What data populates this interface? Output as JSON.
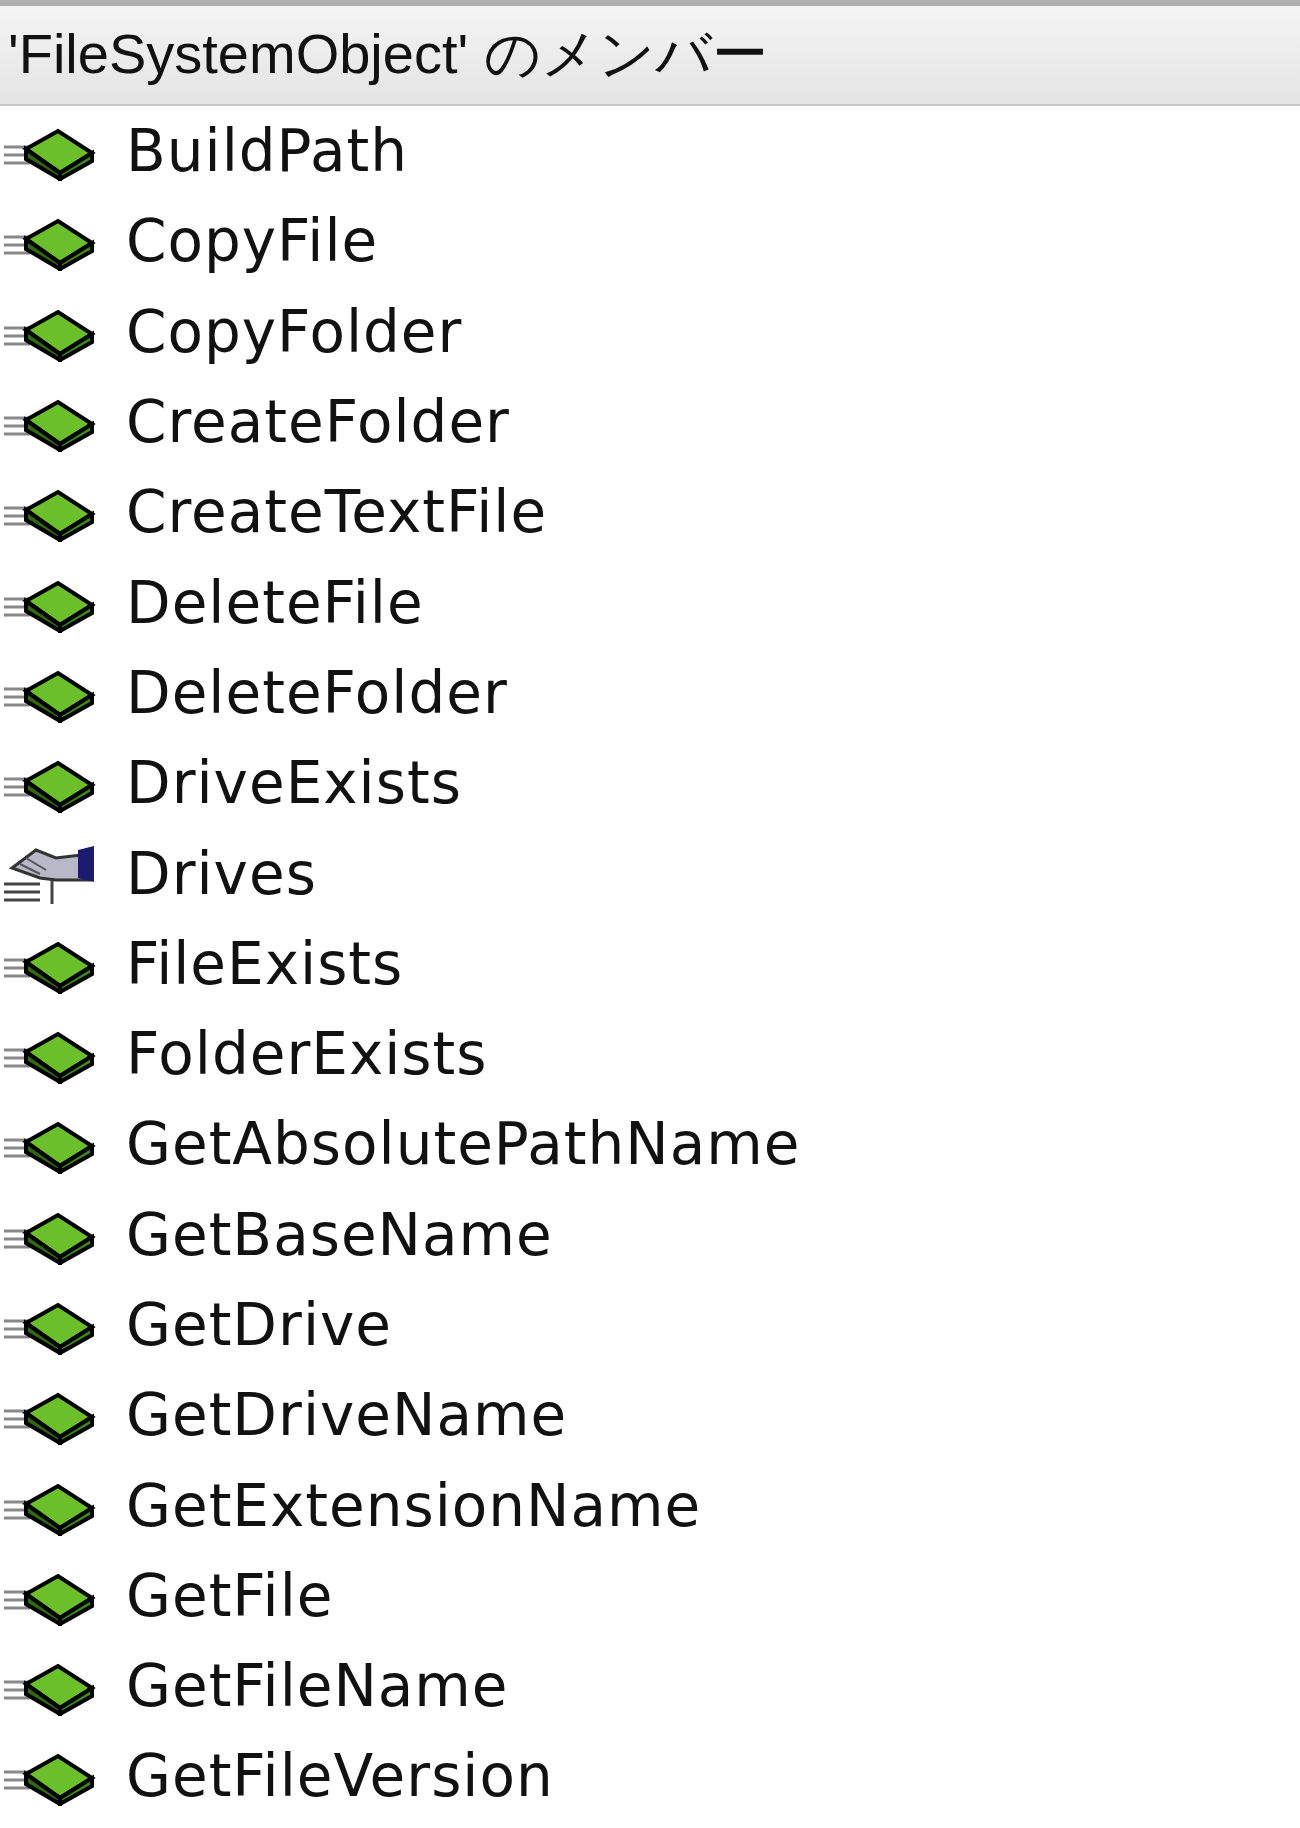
{
  "header": {
    "title": "'FileSystemObject' のメンバー"
  },
  "members": [
    {
      "name": "BuildPath",
      "kind": "method"
    },
    {
      "name": "CopyFile",
      "kind": "method"
    },
    {
      "name": "CopyFolder",
      "kind": "method"
    },
    {
      "name": "CreateFolder",
      "kind": "method"
    },
    {
      "name": "CreateTextFile",
      "kind": "method"
    },
    {
      "name": "DeleteFile",
      "kind": "method"
    },
    {
      "name": "DeleteFolder",
      "kind": "method"
    },
    {
      "name": "DriveExists",
      "kind": "method"
    },
    {
      "name": "Drives",
      "kind": "property"
    },
    {
      "name": "FileExists",
      "kind": "method"
    },
    {
      "name": "FolderExists",
      "kind": "method"
    },
    {
      "name": "GetAbsolutePathName",
      "kind": "method"
    },
    {
      "name": "GetBaseName",
      "kind": "method"
    },
    {
      "name": "GetDrive",
      "kind": "method"
    },
    {
      "name": "GetDriveName",
      "kind": "method"
    },
    {
      "name": "GetExtensionName",
      "kind": "method"
    },
    {
      "name": "GetFile",
      "kind": "method"
    },
    {
      "name": "GetFileName",
      "kind": "method"
    },
    {
      "name": "GetFileVersion",
      "kind": "method"
    }
  ]
}
